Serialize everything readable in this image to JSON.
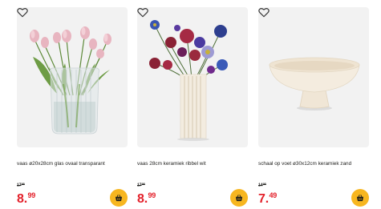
{
  "products": [
    {
      "title": "vaas ø20x28cm glas ovaal transparant",
      "old_price_int": "17",
      "old_price_dec": "95",
      "price_int": "8.",
      "price_dec": "99",
      "image_icon": "glass-vase-tulips",
      "favorite_icon": "heart-outline-icon",
      "cart_icon": "shopping-basket-icon"
    },
    {
      "title": "vaas 28cm keramiek ribbel wit",
      "old_price_int": "17",
      "old_price_dec": "95",
      "price_int": "8.",
      "price_dec": "99",
      "image_icon": "ceramic-vase-flowers",
      "favorite_icon": "heart-outline-icon",
      "cart_icon": "shopping-basket-icon"
    },
    {
      "title": "schaal op voet ø30x12cm keramiek zand",
      "old_price_int": "14",
      "old_price_dec": "95",
      "price_int": "7.",
      "price_dec": "49",
      "image_icon": "footed-bowl",
      "favorite_icon": "heart-outline-icon",
      "cart_icon": "shopping-basket-icon"
    }
  ],
  "colors": {
    "price_red": "#e3202a",
    "cart_yellow": "#f7b61f",
    "image_bg": "#f2f2f2",
    "text": "#1d1d1b"
  }
}
